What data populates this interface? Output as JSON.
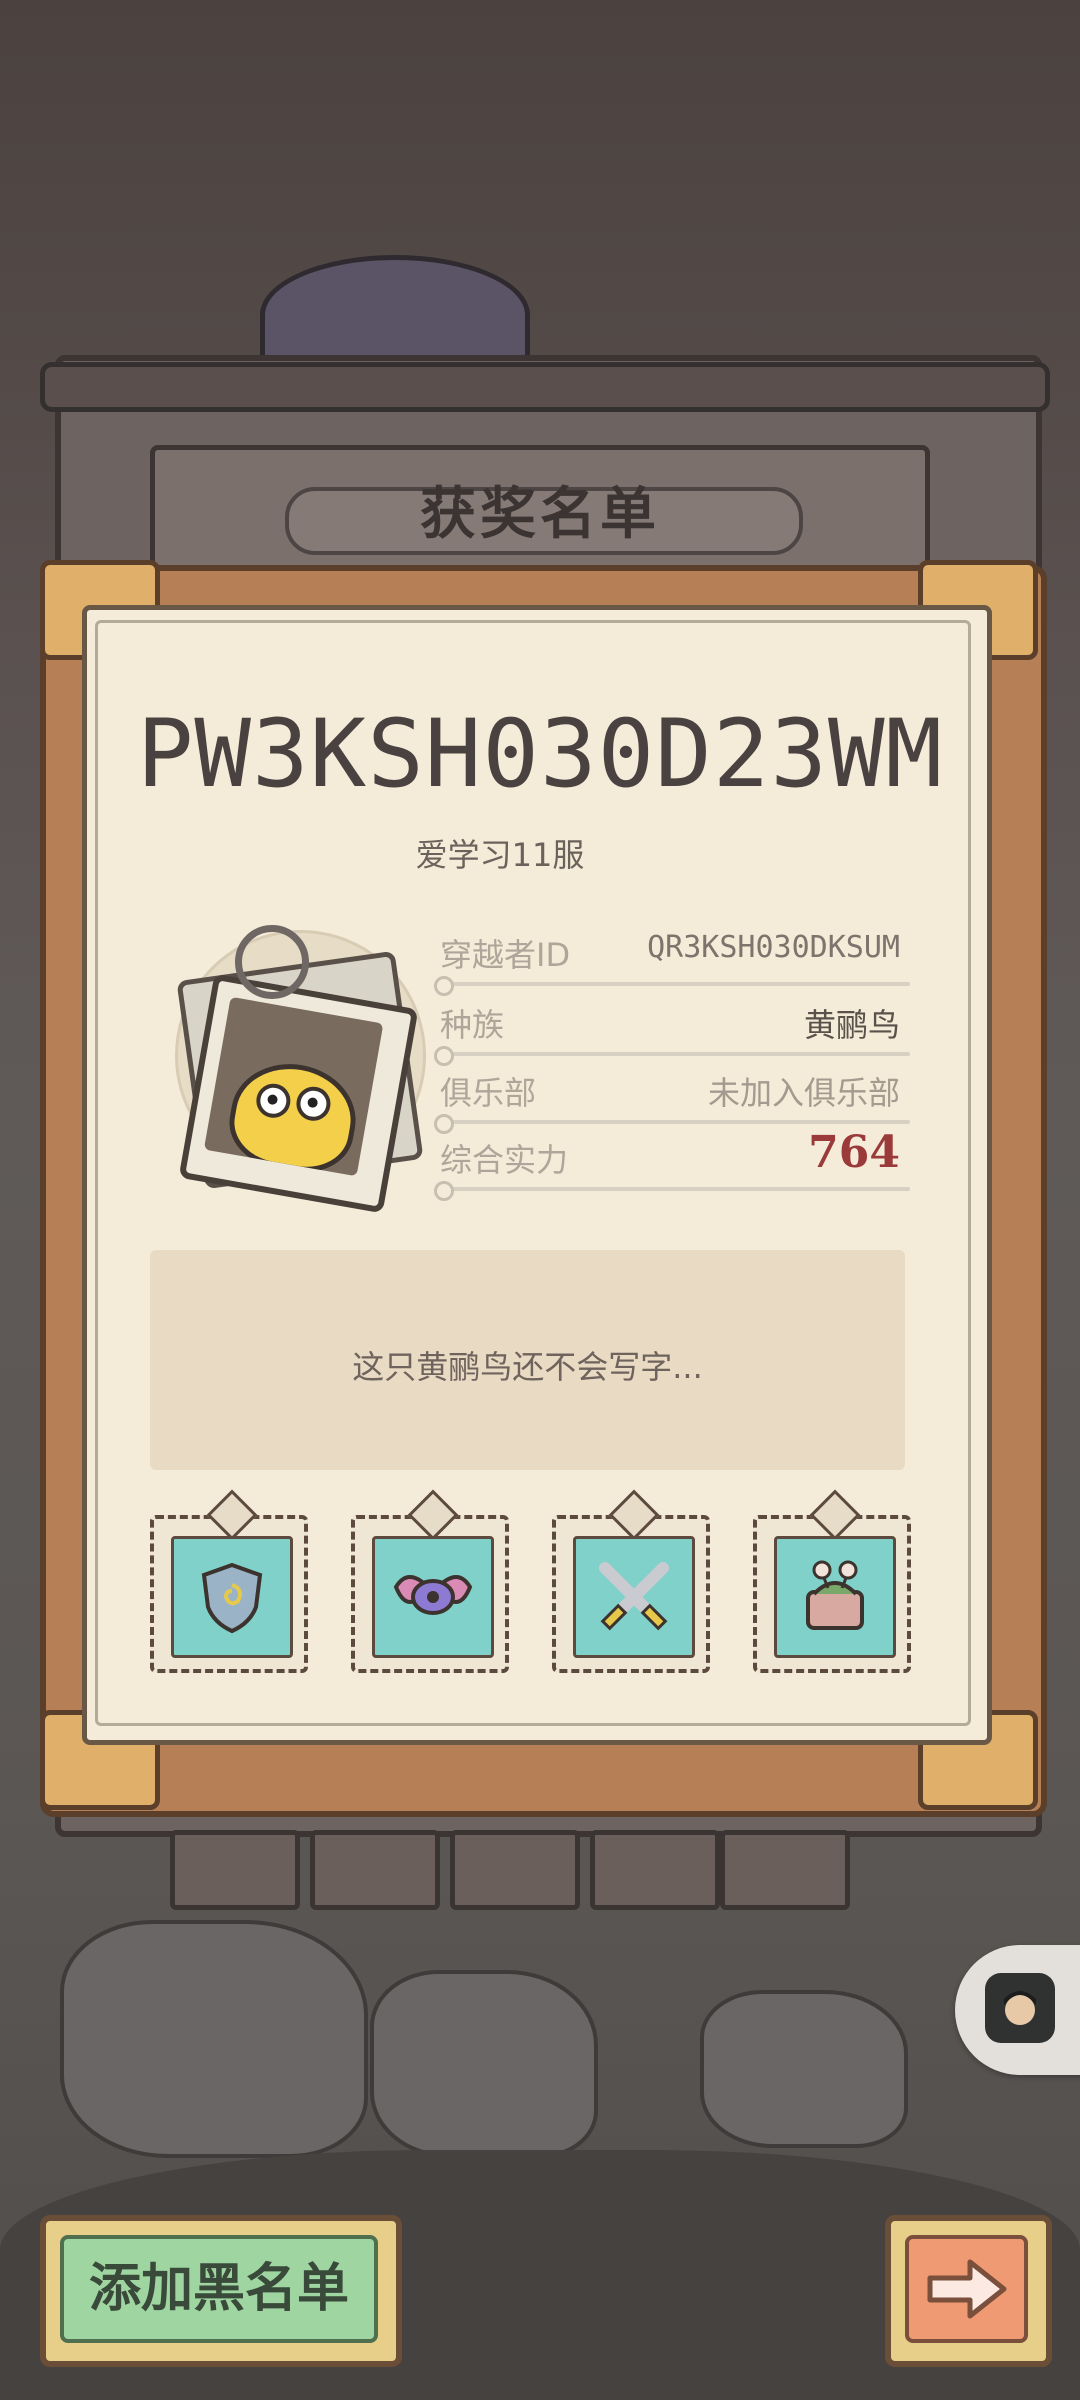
{
  "header": {
    "title": "获奖名单"
  },
  "card": {
    "player_name": "PW3KSH030D23WM",
    "server": "爱学习11服",
    "info": [
      {
        "label": "穿越者ID",
        "value": "QR3KSH030DKSUM"
      },
      {
        "label": "种族",
        "value": "黄鹂鸟"
      },
      {
        "label": "俱乐部",
        "value": "未加入俱乐部"
      },
      {
        "label": "综合实力",
        "value": "764"
      }
    ],
    "bio": "这只黄鹂鸟还不会写字..."
  },
  "badges": [
    {
      "icon": "shield-badge-icon"
    },
    {
      "icon": "winged-eye-badge-icon"
    },
    {
      "icon": "crossed-swords-badge-icon"
    },
    {
      "icon": "snail-creature-badge-icon"
    }
  ],
  "buttons": {
    "blacklist": "添加黑名单",
    "next": "arrow-right-icon"
  },
  "colors": {
    "power_value": "#9b3a3a",
    "card_bg": "#f4ecd8",
    "frame": "#b77f55",
    "blacklist_button": "#9fd5a0",
    "next_button": "#f09a74"
  }
}
